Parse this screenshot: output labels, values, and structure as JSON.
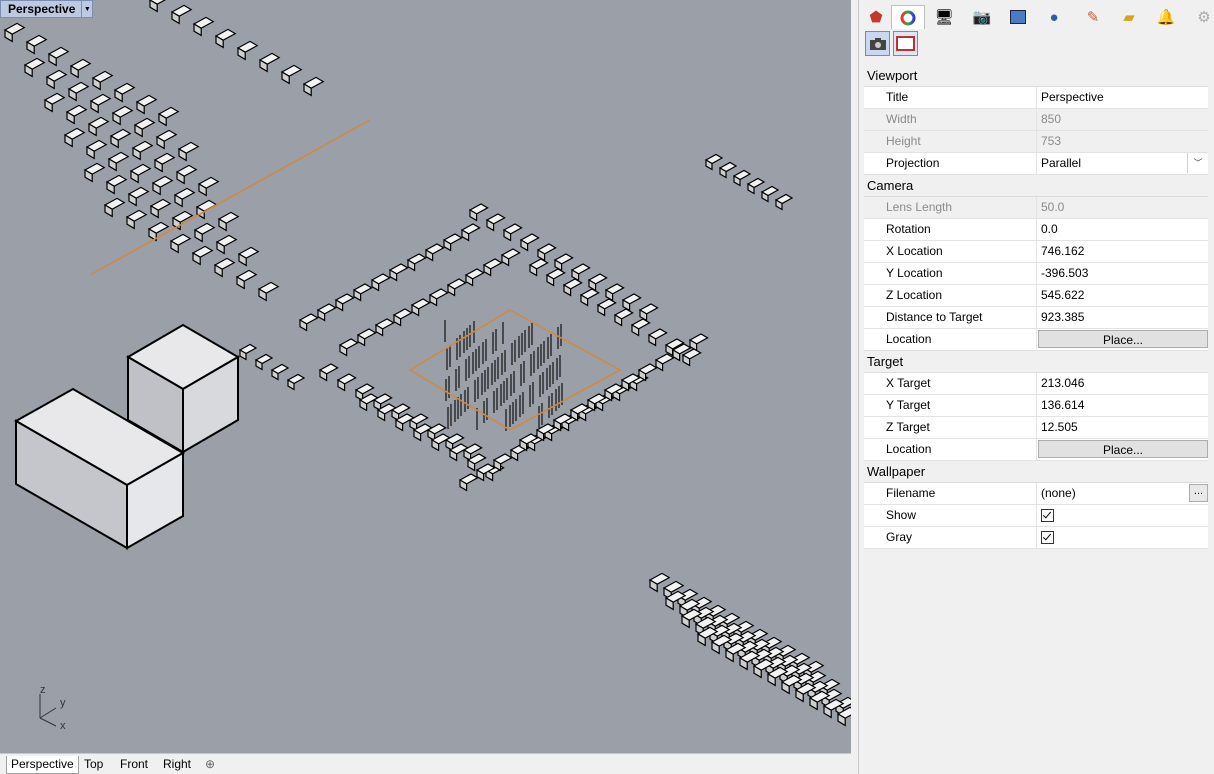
{
  "viewport": {
    "title": "Perspective"
  },
  "axis": {
    "z": "z",
    "y": "y",
    "x": "x"
  },
  "view_tabs": [
    "Perspective",
    "Top",
    "Front",
    "Right"
  ],
  "add_tab_icon": "plus-icon",
  "panel_tab_icons": [
    "material-icon",
    "display-color-icon",
    "display-icon",
    "named-views-icon",
    "layer-states-icon",
    "render-icon",
    "brush-icon",
    "files-icon",
    "notifications-icon",
    "settings-icon"
  ],
  "properties": {
    "viewport_section": "Viewport",
    "title_label": "Title",
    "title_value": "Perspective",
    "width_label": "Width",
    "width_value": "850",
    "height_label": "Height",
    "height_value": "753",
    "projection_label": "Projection",
    "projection_value": "Parallel",
    "camera_section": "Camera",
    "lens_label": "Lens Length",
    "lens_value": "50.0",
    "rotation_label": "Rotation",
    "rotation_value": "0.0",
    "xloc_label": "X Location",
    "xloc_value": "746.162",
    "yloc_label": "Y Location",
    "yloc_value": "-396.503",
    "zloc_label": "Z Location",
    "zloc_value": "545.622",
    "dist_label": "Distance to Target",
    "dist_value": "923.385",
    "camloc_label": "Location",
    "camloc_button": "Place...",
    "target_section": "Target",
    "xt_label": "X Target",
    "xt_value": "213.046",
    "yt_label": "Y Target",
    "yt_value": "136.614",
    "zt_label": "Z Target",
    "zt_value": "12.505",
    "tloc_label": "Location",
    "tloc_button": "Place...",
    "wallpaper_section": "Wallpaper",
    "filename_label": "Filename",
    "filename_value": "(none)",
    "browse_button": "...",
    "show_label": "Show",
    "show_checked": true,
    "gray_label": "Gray",
    "gray_checked": true
  }
}
